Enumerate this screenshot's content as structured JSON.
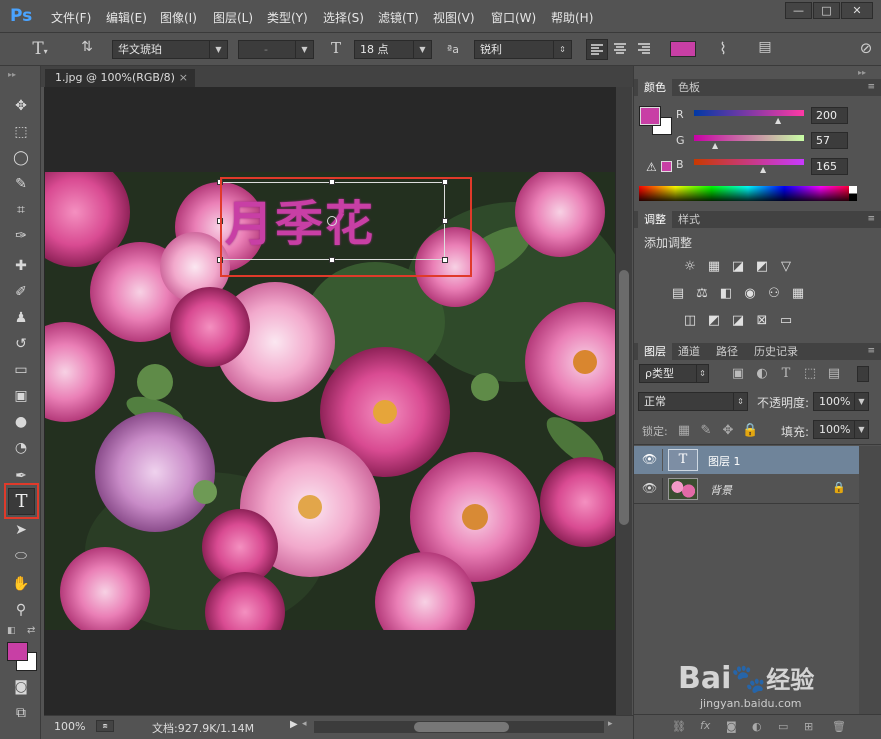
{
  "app": {
    "logo": "Ps"
  },
  "menu": [
    "文件(F)",
    "编辑(E)",
    "图像(I)",
    "图层(L)",
    "类型(Y)",
    "选择(S)",
    "滤镜(T)",
    "视图(V)",
    "窗口(W)",
    "帮助(H)"
  ],
  "window_buttons": {
    "minimize": "—",
    "maximize": "□",
    "close": "✕"
  },
  "options": {
    "font_family": "华文琥珀",
    "font_style": "-",
    "font_size": "18 点",
    "aa_label": "ªa",
    "antialias": "锐利",
    "text_color": "#c83fa5"
  },
  "document": {
    "tab_title": "1.jpg @ 100%(RGB/8)",
    "tab_close": "×",
    "text_layer_content": "月季花"
  },
  "status": {
    "zoom": "100%",
    "doc_info": "文档:927.9K/1.14M"
  },
  "color_panel": {
    "tabs": [
      "颜色",
      "色板"
    ],
    "channels": [
      {
        "label": "R",
        "value": "200"
      },
      {
        "label": "G",
        "value": "57"
      },
      {
        "label": "B",
        "value": "165"
      }
    ],
    "foreground": "#c83fa5",
    "background": "#ffffff"
  },
  "adjust_panel": {
    "tabs": [
      "调整",
      "样式"
    ],
    "heading": "添加调整"
  },
  "layers_panel": {
    "tabs": [
      "图层",
      "通道",
      "路径",
      "历史记录"
    ],
    "filter_label": "ρ类型",
    "blend_mode": "正常",
    "opacity_label": "不透明度:",
    "opacity_value": "100%",
    "lock_label": "锁定:",
    "fill_label": "填充:",
    "fill_value": "100%",
    "layers": [
      {
        "name": "图层 1",
        "thumb": "T",
        "selected": true
      },
      {
        "name": "背景",
        "selected": false,
        "locked": true
      }
    ]
  },
  "watermark": {
    "brand": "Bai",
    "suffix": "经验",
    "url": "jingyan.baidu.com"
  }
}
